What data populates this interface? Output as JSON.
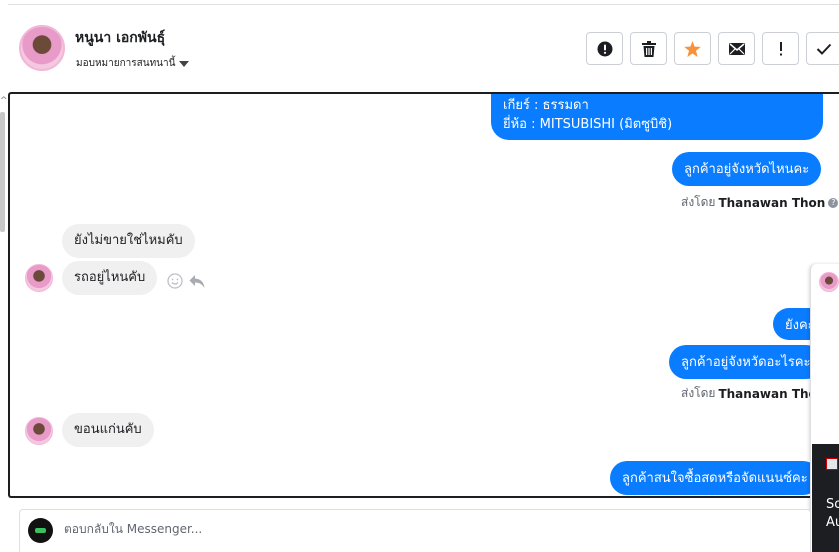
{
  "header": {
    "contact_name": "หนูนา เอกพันธุ์",
    "assign_label": "มอบหมายการสนทนานี้"
  },
  "actions": [
    {
      "name": "mark-spam-button",
      "icon": "exclamation-circle-icon"
    },
    {
      "name": "delete-button",
      "icon": "trash-icon"
    },
    {
      "name": "star-button",
      "icon": "star-icon",
      "color": "#f7923b"
    },
    {
      "name": "mark-unread-button",
      "icon": "envelope-icon"
    },
    {
      "name": "follow-up-button",
      "icon": "exclamation-icon"
    },
    {
      "name": "mark-done-button",
      "icon": "checkmark-icon"
    }
  ],
  "messages": {
    "m1_line1": "เกียร์ : ธรรมดา",
    "m1_line2": "ยี่ห้อ : MITSUBISHI (มิตซูบิชิ)",
    "m2": "ลูกค้าอยู่จังหวัดไหนคะ",
    "m2_sent_prefix": "ส่งโดย",
    "m2_sent_name": "Thanawan Thon",
    "m3": "ยังไม่ขายใช่ไหมคับ",
    "m4": "รถอยู่ไหนคับ",
    "m5": "ยังคะ",
    "m6": "ลูกค้าอยู่จังหวัดอะไรคะ",
    "m6_sent_prefix": "ส่งโดย",
    "m6_sent_name": "Thanawan Thon",
    "m7": "ขอนแก่นคับ",
    "m8": "ลูกค้าสนใจซื้อสดหรือจัดแนนซ์คะ"
  },
  "popup": {
    "line1": "So",
    "line2": "Au"
  },
  "reply": {
    "placeholder": "ตอบกลับใน Messenger..."
  },
  "colors": {
    "outgoing_bubble": "#0a7cff",
    "incoming_bubble": "#f0f0f0",
    "star": "#f7923b"
  }
}
